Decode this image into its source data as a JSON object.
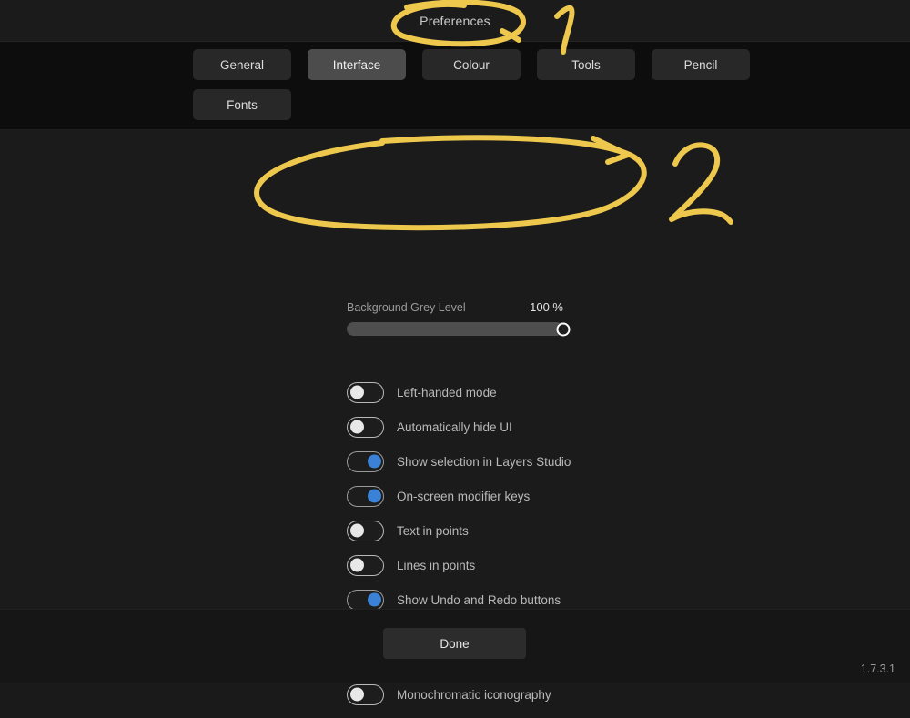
{
  "window": {
    "title": "Preferences",
    "version": "1.7.3.1"
  },
  "tabs": {
    "row1": [
      {
        "label": "General",
        "selected": false
      },
      {
        "label": "Interface",
        "selected": true
      },
      {
        "label": "Colour",
        "selected": false
      },
      {
        "label": "Tools",
        "selected": false
      },
      {
        "label": "Pencil",
        "selected": false
      }
    ],
    "row2": [
      {
        "label": "Fonts",
        "selected": false
      }
    ]
  },
  "interface_panel": {
    "slider": {
      "label": "Background Grey Level",
      "value_text": "100 %",
      "value": 100,
      "min": 0,
      "max": 100
    },
    "toggles": [
      {
        "label": "Left-handed mode",
        "on": false
      },
      {
        "label": "Automatically hide UI",
        "on": false
      },
      {
        "label": "Show selection in Layers Studio",
        "on": true
      },
      {
        "label": "On-screen modifier keys",
        "on": true
      },
      {
        "label": "Text in points",
        "on": false
      },
      {
        "label": "Lines in points",
        "on": false
      },
      {
        "label": "Show Undo and Redo buttons",
        "on": true
      }
    ],
    "toggles_detached": [
      {
        "label": "Monochromatic iconography",
        "on": false
      }
    ]
  },
  "footer": {
    "done_label": "Done"
  },
  "annotations": {
    "color": "#edc84d",
    "marks": [
      {
        "name": "circle-around-title",
        "number": "1"
      },
      {
        "name": "ellipse-around-slider",
        "number": "2"
      }
    ]
  },
  "colors": {
    "accent_blue": "#3b82d6",
    "annotation_yellow": "#edc84d",
    "window_bg": "#1b1b1b",
    "tabbar_bg": "#0d0d0d",
    "tab_selected": "#4c4c4c"
  }
}
